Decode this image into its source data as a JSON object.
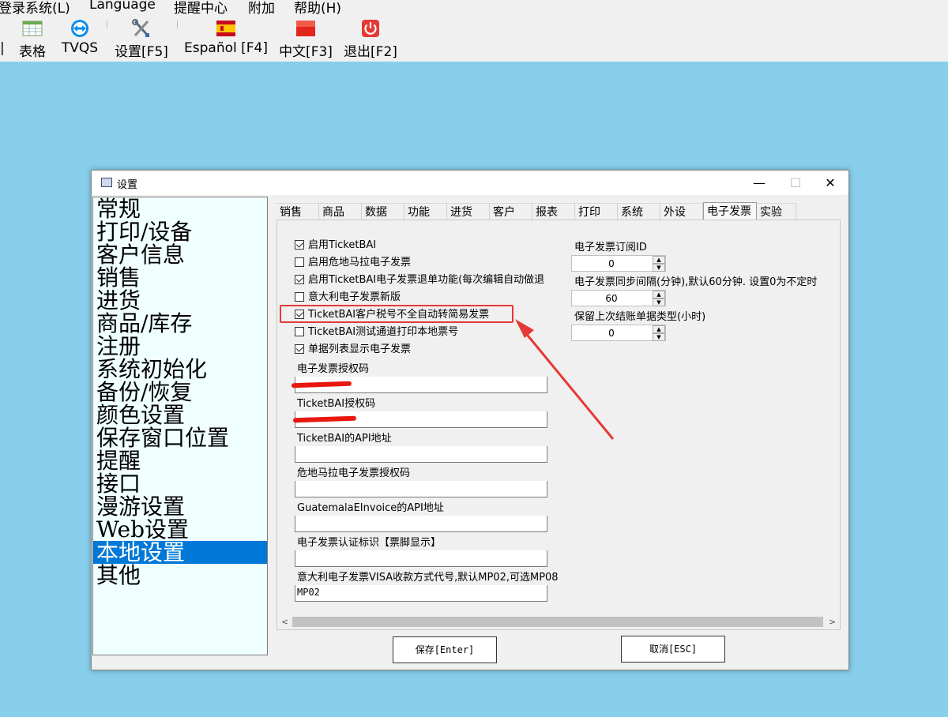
{
  "menubar": {
    "items": [
      "登录系统(L)",
      "Language",
      "提醒中心",
      "附加",
      "帮助(H)"
    ]
  },
  "toolbar": {
    "left_edge": "|",
    "items": [
      {
        "label": "表格",
        "icon": "table-icon"
      },
      {
        "label": "TVQS",
        "icon": "teamviewer-icon"
      },
      {
        "label": "设置[F5]",
        "icon": "tools-icon"
      },
      {
        "label": "Español [F4]",
        "icon": "spain-flag-icon"
      },
      {
        "label": "中文[F3]",
        "icon": "china-flag-icon"
      },
      {
        "label": "退出[F2]",
        "icon": "power-icon"
      }
    ]
  },
  "dialog": {
    "title": "设置",
    "controls": {
      "minimize": "—",
      "maximize": "☐",
      "close": "✕"
    },
    "sidebar": {
      "items": [
        "常规",
        "打印/设备",
        "客户信息",
        "销售",
        "进货",
        "商品/库存",
        "注册",
        "系统初始化",
        "备份/恢复",
        "颜色设置",
        "保存窗口位置",
        "提醒",
        "接口",
        "漫游设置",
        "Web设置",
        "本地设置",
        "其他"
      ],
      "selected": "本地设置"
    },
    "tabs": [
      "销售",
      "商品",
      "数据",
      "功能",
      "进货",
      "客户",
      "报表",
      "打印",
      "系统",
      "外设",
      "电子发票",
      "实验"
    ],
    "active_tab": "电子发票",
    "checkboxes": [
      {
        "label": "启用TicketBAI",
        "checked": true
      },
      {
        "label": "启用危地马拉电子发票",
        "checked": false
      },
      {
        "label": "启用TicketBAI电子发票退单功能(每次编辑自动做退",
        "checked": true
      },
      {
        "label": "意大利电子发票新版",
        "checked": false
      },
      {
        "label": "TicketBAI客户税号不全自动转简易发票",
        "checked": true
      },
      {
        "label": "TicketBAI测试通道打印本地票号",
        "checked": false
      },
      {
        "label": "单据列表显示电子发票",
        "checked": true
      }
    ],
    "fields": [
      {
        "label": "电子发票授权码",
        "value": ""
      },
      {
        "label": "TicketBAI授权码",
        "value": ""
      },
      {
        "label": "TicketBAI的API地址",
        "value": ""
      },
      {
        "label": "危地马拉电子发票授权码",
        "value": ""
      },
      {
        "label": "GuatemalaEInvoice的API地址",
        "value": ""
      },
      {
        "label": "电子发票认证标识【票脚显示】",
        "value": ""
      },
      {
        "label": "意大利电子发票VISA收款方式代号,默认MP02,可选MP08",
        "value": "MP02"
      }
    ],
    "right_fields": [
      {
        "label": "电子发票订阅ID",
        "value": "0"
      },
      {
        "label": "电子发票同步间隔(分钟),默认60分钟. 设置0为不定时",
        "value": "60"
      },
      {
        "label": "保留上次结账单据类型(小时)",
        "value": "0"
      }
    ],
    "scroll": {
      "left": "<",
      "right": ">"
    },
    "buttons": {
      "save": "保存[Enter]",
      "cancel": "取消[ESC]"
    }
  },
  "colors": {
    "desktop": "#87ceeb",
    "highlight": "#e53935",
    "selection": "#0078d7",
    "sidebar_bg": "#f0ffff"
  }
}
